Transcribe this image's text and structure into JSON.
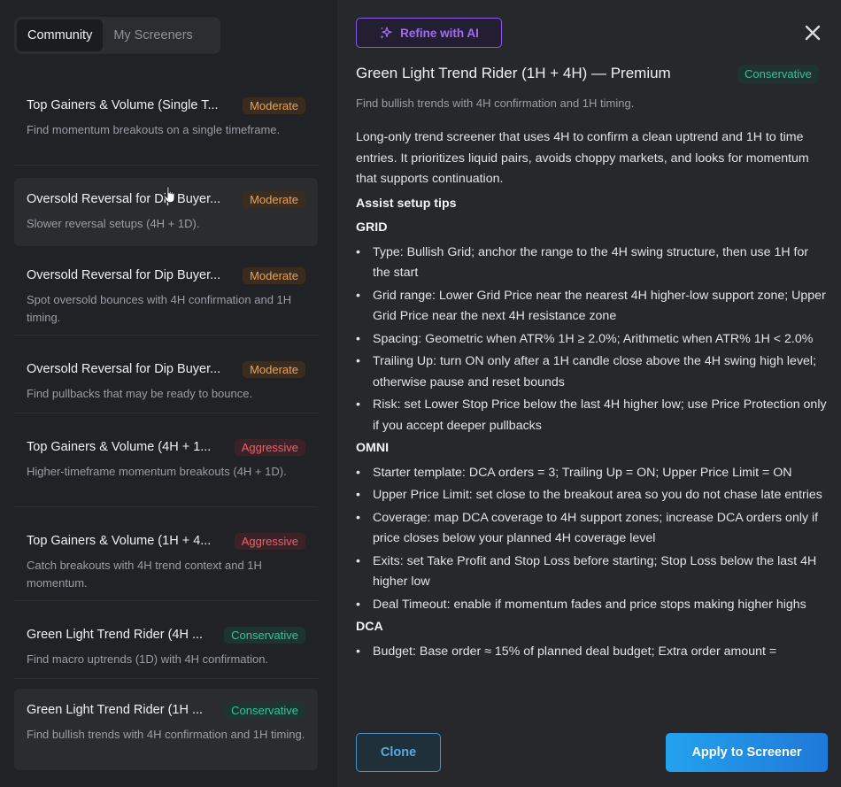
{
  "tabs": [
    {
      "label": "Community"
    },
    {
      "label": "My Screeners"
    }
  ],
  "screeners": [
    {
      "title": "Top Gainers & Volume (Single T...",
      "risk": "Moderate",
      "desc": "Find momentum breakouts on a single timeframe."
    },
    {
      "title": "Oversold Reversal for Dip Buyer...",
      "risk": "Moderate",
      "desc": "Slower reversal setups (4H + 1D)."
    },
    {
      "title": "Oversold Reversal for Dip Buyer...",
      "risk": "Moderate",
      "desc": "Spot oversold bounces with 4H confirmation and 1H timing."
    },
    {
      "title": "Oversold Reversal for Dip Buyer...",
      "risk": "Moderate",
      "desc": "Find pullbacks that may be ready to bounce."
    },
    {
      "title": "Top Gainers & Volume (4H + 1...",
      "risk": "Aggressive",
      "desc": "Higher-timeframe momentum breakouts (4H + 1D)."
    },
    {
      "title": "Top Gainers & Volume (1H + 4...",
      "risk": "Aggressive",
      "desc": "Catch breakouts with 4H trend context and 1H momentum."
    },
    {
      "title": "Green Light Trend Rider (4H ...",
      "risk": "Conservative",
      "desc": "Find macro uptrends (1D) with 4H confirmation."
    },
    {
      "title": "Green Light Trend Rider (1H ...",
      "risk": "Conservative",
      "desc": "Find bullish trends with 4H confirmation and 1H timing."
    }
  ],
  "detail": {
    "ai_button": "Refine with AI",
    "title": "Green Light Trend Rider (1H + 4H) — Premium",
    "risk": "Conservative",
    "subtitle": "Find bullish trends with 4H confirmation and 1H timing.",
    "intro": "Long-only trend screener that uses 4H to confirm a clean uptrend and 1H to time entries. It prioritizes liquid pairs, avoids choppy markets, and looks for momentum that supports continuation.",
    "tips_heading": "Assist setup tips",
    "grid_heading": "GRID",
    "grid": [
      "Type: Bullish Grid; anchor the range to the 4H swing structure, then use 1H for the start",
      "Grid range: Lower Grid Price near the nearest 4H higher-low support zone; Upper Grid Price near the next 4H resistance zone",
      "Spacing: Geometric when ATR% 1H ≥ 2.0%; Arithmetic when ATR% 1H < 2.0%",
      "Trailing Up: turn ON only after a 1H candle close above the 4H swing high level; otherwise pause and reset bounds",
      "Risk: set Lower Stop Price below the last 4H higher low; use Price Protection only if you accept deeper pullbacks"
    ],
    "omni_heading": "OMNI",
    "omni": [
      "Starter template: DCA orders = 3; Trailing Up = ON; Upper Price Limit = ON",
      "Upper Price Limit: set close to the breakout area so you do not chase late entries",
      "Coverage: map DCA coverage to 4H support zones; increase DCA orders only if price closes below your planned 4H coverage level",
      "Exits: set Take Profit and Stop Loss before starting; Stop Loss below the last 4H higher low",
      "Deal Timeout: enable if momentum fades and price stops making higher highs"
    ],
    "dca_heading": "DCA",
    "dca": [
      "Budget: Base order ≈ 15% of planned deal budget; Extra order amount ="
    ],
    "clone_label": "Clone",
    "apply_label": "Apply to Screener"
  }
}
